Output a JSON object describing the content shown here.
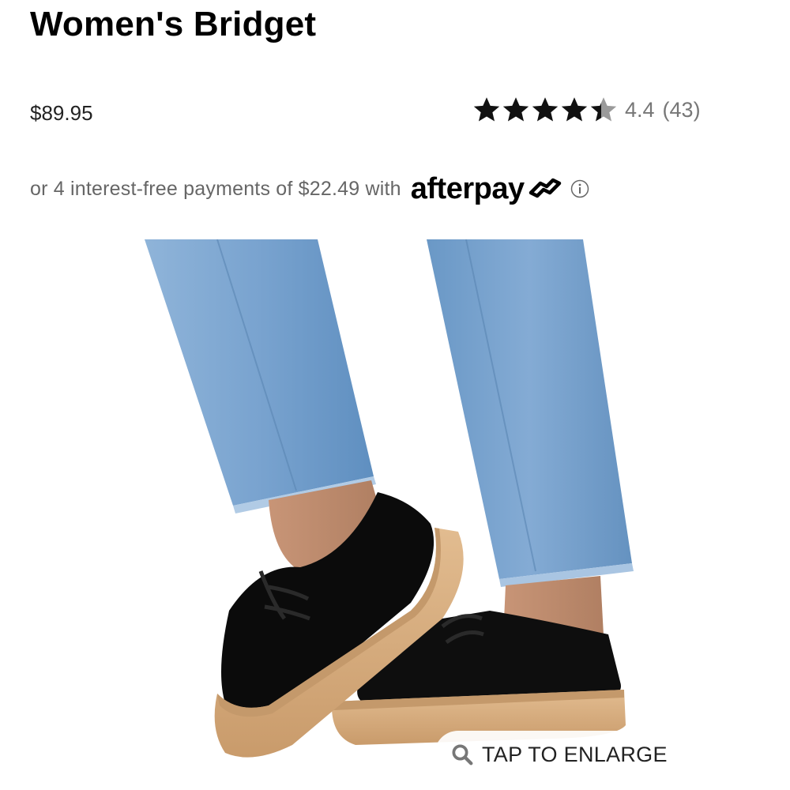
{
  "product": {
    "title": "Women's Bridget",
    "price": "$89.95"
  },
  "rating": {
    "score": "4.4",
    "count": "(43)",
    "stars_value": 4.4,
    "stars_max": 5
  },
  "afterpay": {
    "text": "or 4 interest-free payments of $22.49 with",
    "brand": "afterpay"
  },
  "image": {
    "alt": "product photo",
    "enlarge_label": "TAP TO ENLARGE"
  },
  "colors": {
    "star_filled": "#111111",
    "star_empty": "#9a9a9a",
    "denim": "#7da6cf",
    "shoe": "#0c0c0c",
    "sole": "#d8ad7d"
  },
  "icons": [
    "star-icon",
    "afterpay-arrows-icon",
    "info-icon",
    "search-icon"
  ]
}
